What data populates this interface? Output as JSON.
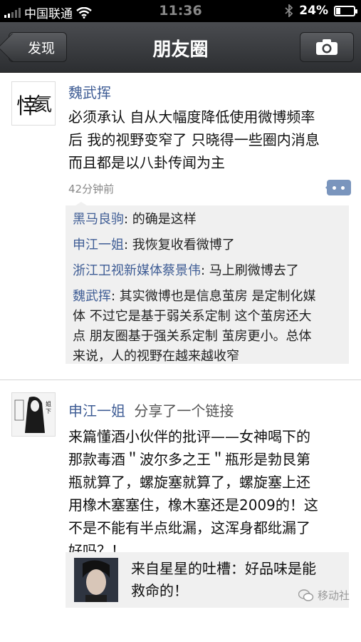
{
  "status_bar": {
    "carrier": "中国联通",
    "time": "11:36",
    "battery_text": "24%",
    "battery_level": 0.24
  },
  "nav": {
    "back_label": "发现",
    "title": "朋友圈",
    "camera_icon": "camera-icon"
  },
  "posts": [
    {
      "author": "魏武挥",
      "text": [
        "必须承认 自从大幅度降低使用微博频率",
        "后 我的视野变窄了 只晓得一些圈内消息",
        "而且都是以八卦传闻为主"
      ],
      "time": "42分钟前",
      "comments": [
        {
          "author": "黑马良驹",
          "text": ": 的确是这样"
        },
        {
          "author": "申江一姐",
          "text": ": 我恢复收看微博了"
        },
        {
          "author": "浙江卫视新媒体蔡景伟",
          "text": ": 马上刷微博去了"
        },
        {
          "author": "魏武挥",
          "text": ": 其实微博也是信息茧房 是定制化媒",
          "more": [
            "体 不过它是基于弱关系定制 这个茧房还大",
            "点 朋友圈基于强关系定制 茧房更小。总体",
            "来说，人的视野在越来越收窄"
          ]
        }
      ]
    },
    {
      "author": "申江一姐",
      "action": "分享了一个链接",
      "text": [
        "来篇懂酒小伙伴的批评——女神喝下的",
        "那款毒酒＂波尔多之王＂瓶形是勃艮第",
        "瓶就算了，螺旋塞就算了，螺旋塞上还",
        "用橡木塞塞住，橡木塞还是2009的！这",
        "不是不能有半点纰漏，这浑身都纰漏了",
        "好吗？！"
      ],
      "link": {
        "title": [
          "来自星星的吐槽：好品味是能",
          "救命的！"
        ]
      }
    }
  ],
  "watermark": "移动社"
}
